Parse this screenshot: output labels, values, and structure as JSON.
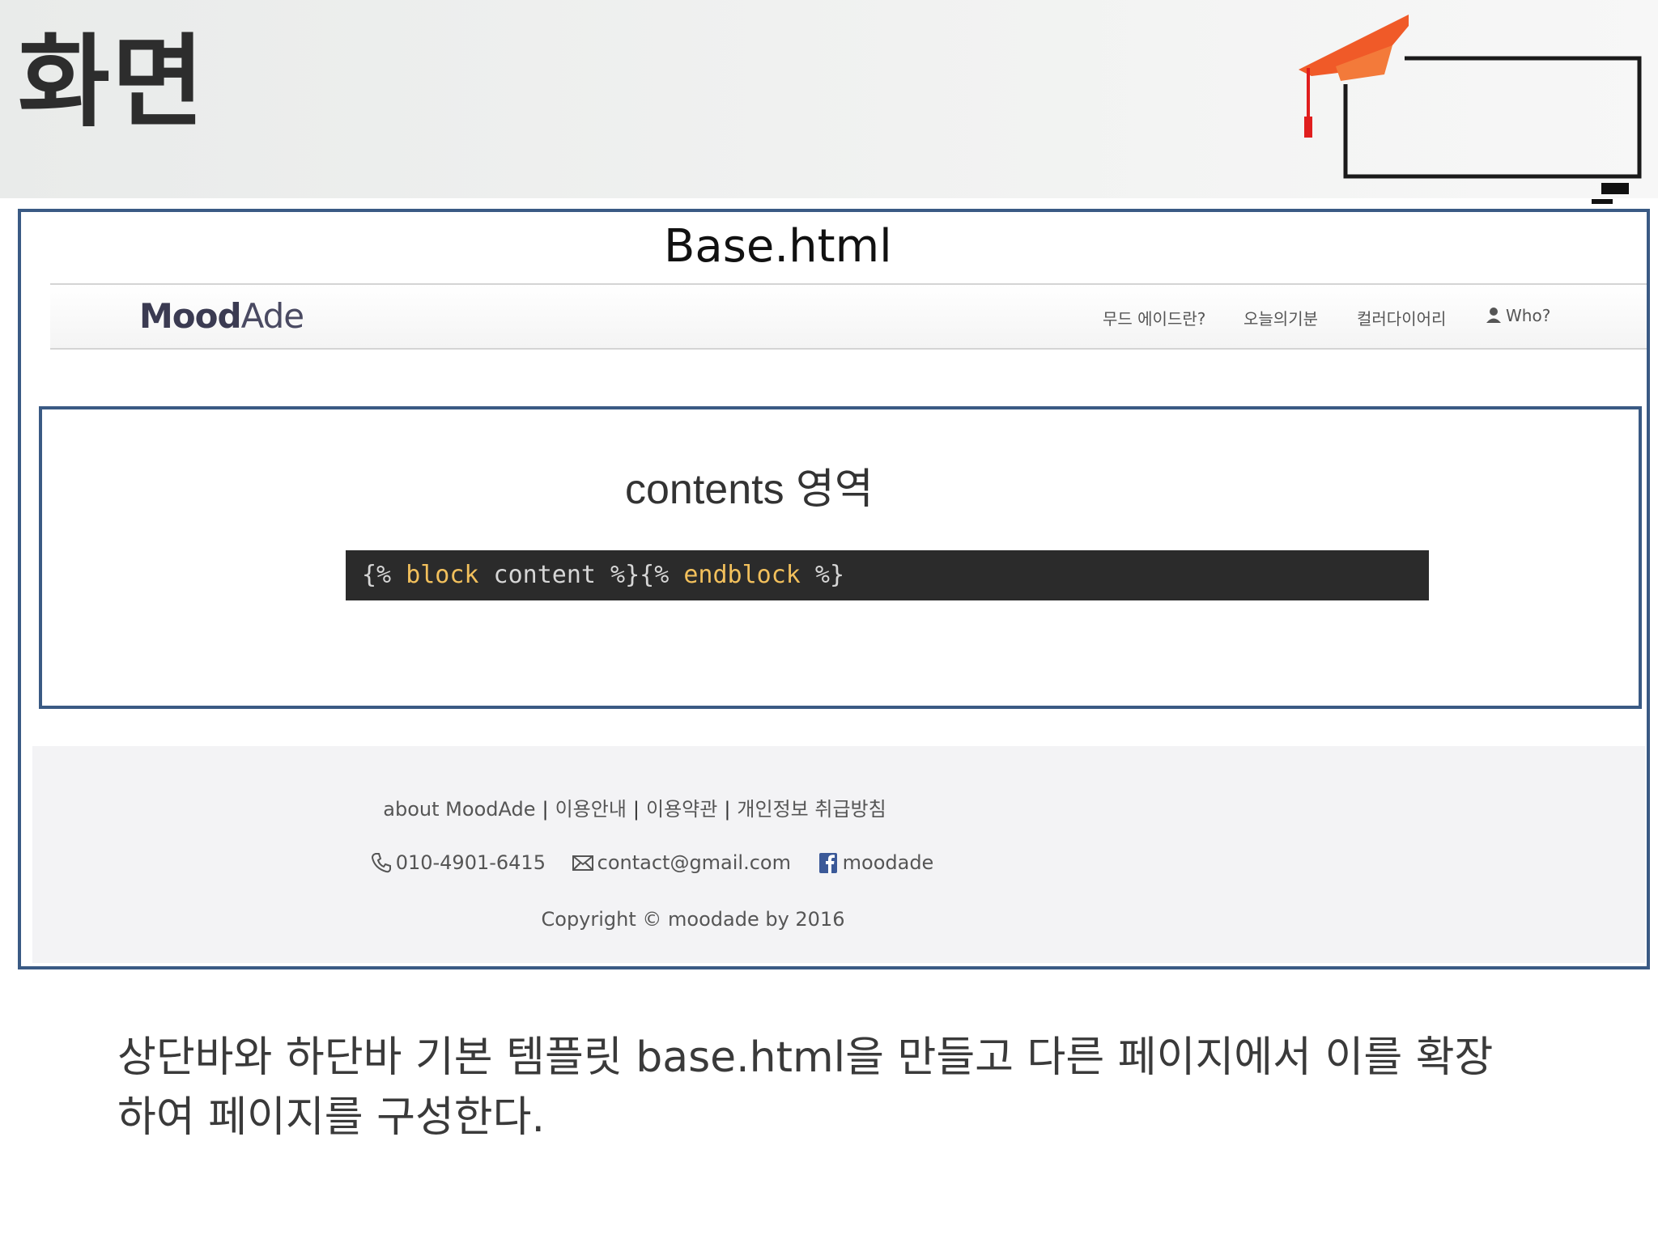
{
  "slide": {
    "title": "화면",
    "description_line1": "상단바와 하단바 기본 템플릿 base.html을 만들고 다른 페이지에서 이를 확장",
    "description_line2": "하여 페이지를 구성한다."
  },
  "base_frame": {
    "label": "Base.html"
  },
  "navbar": {
    "logo_bold": "Mood",
    "logo_thin": "Ade",
    "items": [
      {
        "label": "무드 에이드란?"
      },
      {
        "label": "오늘의기분"
      },
      {
        "label": "컬러다이어리"
      },
      {
        "label": "Who?",
        "icon": "user-icon"
      }
    ]
  },
  "content_area": {
    "label": "contents 영역",
    "code": {
      "open_brace": "{% ",
      "kw1": "block",
      "middle": " content %}{% ",
      "kw2": "endblock",
      "close_brace": " %}"
    }
  },
  "footer": {
    "links": [
      "about MoodAde",
      "이용안내",
      "이용약관",
      "개인정보 취급방침"
    ],
    "separator": "|",
    "phone": "010-4901-6415",
    "email": "contact@gmail.com",
    "facebook": "moodade",
    "copyright": "Copyright © moodade by 2016"
  },
  "colors": {
    "frame_border": "#3a5a84",
    "code_bg": "#2b2b2b",
    "code_keyword": "#f2c05c",
    "cap_orange": "#f05a28",
    "tassel_red": "#e01e1e"
  }
}
